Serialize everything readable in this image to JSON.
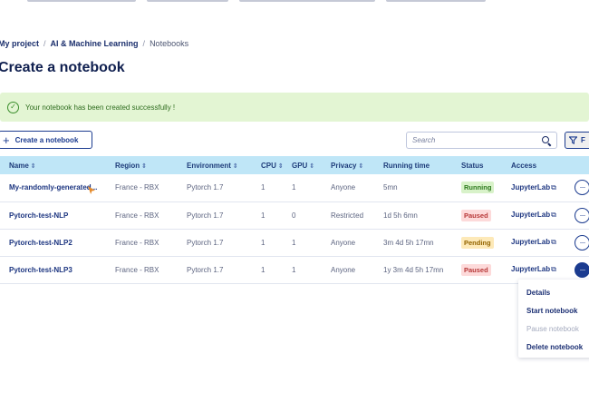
{
  "breadcrumb": {
    "items": [
      "My project",
      "AI & Machine Learning",
      "Notebooks"
    ],
    "separator": "/"
  },
  "page_title": "Create a notebook",
  "alert": {
    "message": "Your notebook has been created successfully !",
    "icon": "check-circle-icon",
    "color": "#3a8e2b"
  },
  "toolbar": {
    "create_label": "Create a notebook",
    "search_placeholder": "Search",
    "filter_label": "F"
  },
  "table": {
    "columns": [
      "Name",
      "Region",
      "Environment",
      "CPU",
      "GPU",
      "Privacy",
      "Running time",
      "Status",
      "Access"
    ],
    "rows": [
      {
        "name": "My-randomly-generated...",
        "region": "France - RBX",
        "environment": "Pytorch 1.7",
        "cpu": "1",
        "gpu": "1",
        "privacy": "Anyone",
        "running_time": "5mn",
        "status": "Running",
        "access": "JupyterLab"
      },
      {
        "name": "Pytorch-test-NLP",
        "region": "France - RBX",
        "environment": "Pytorch 1.7",
        "cpu": "1",
        "gpu": "0",
        "privacy": "Restricted",
        "running_time": "1d 5h 6mn",
        "status": "Paused",
        "access": "JupyterLab"
      },
      {
        "name": "Pytorch-test-NLP2",
        "region": "France - RBX",
        "environment": "Pytorch 1.7",
        "cpu": "1",
        "gpu": "1",
        "privacy": "Anyone",
        "running_time": "3m 4d 5h 17mn",
        "status": "Pending",
        "access": "JupyterLab"
      },
      {
        "name": "Pytorch-test-NLP3",
        "region": "France - RBX",
        "environment": "Pytorch 1.7",
        "cpu": "1",
        "gpu": "1",
        "privacy": "Anyone",
        "running_time": "1y 3m 4d 5h 17mn",
        "status": "Paused",
        "access": "JupyterLab"
      }
    ]
  },
  "action_menu": {
    "items": [
      "Details",
      "Start notebook",
      "Pause notebook",
      "Delete notebook"
    ]
  },
  "colors": {
    "header_bg": "#bfe6f7",
    "alert_bg": "#e3f5d3",
    "primary": "#1b3b8f",
    "running": "#2d7a1d",
    "paused": "#b73838",
    "pending": "#936400"
  }
}
